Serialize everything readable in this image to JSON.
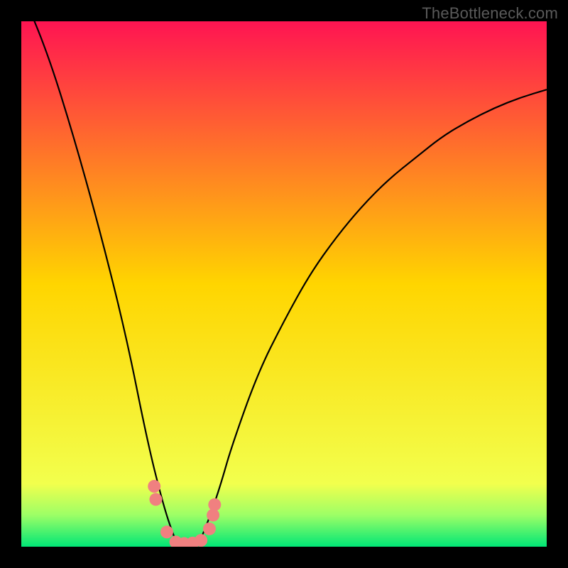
{
  "watermark": "TheBottleneck.com",
  "chart_data": {
    "type": "line",
    "title": "",
    "xlabel": "",
    "ylabel": "",
    "xlim": [
      0,
      100
    ],
    "ylim": [
      0,
      100
    ],
    "background_gradient": {
      "stops": [
        {
          "offset": 0,
          "color": "#ff1452"
        },
        {
          "offset": 50,
          "color": "#ffd500"
        },
        {
          "offset": 88,
          "color": "#f2ff4d"
        },
        {
          "offset": 94,
          "color": "#9cff66"
        },
        {
          "offset": 100,
          "color": "#00e676"
        }
      ]
    },
    "series": [
      {
        "name": "curve",
        "x": [
          0,
          5,
          10,
          15,
          20,
          24,
          27,
          29,
          30,
          31,
          32,
          33,
          34,
          36,
          38,
          40,
          45,
          50,
          55,
          60,
          65,
          70,
          75,
          80,
          85,
          90,
          95,
          100
        ],
        "y": [
          106,
          94,
          78,
          60,
          40,
          20,
          8,
          2,
          0,
          0,
          0,
          0,
          1,
          6,
          12,
          19,
          33,
          43,
          52,
          59,
          65,
          70,
          74,
          78,
          81,
          83.5,
          85.5,
          87
        ]
      }
    ],
    "markers": {
      "name": "highlight-dots",
      "radius": 9,
      "color": "#f08080",
      "points": [
        {
          "x": 25.3,
          "y": 11.5
        },
        {
          "x": 25.6,
          "y": 9.0
        },
        {
          "x": 27.7,
          "y": 2.8
        },
        {
          "x": 29.4,
          "y": 0.9
        },
        {
          "x": 31.0,
          "y": 0.6
        },
        {
          "x": 32.6,
          "y": 0.7
        },
        {
          "x": 34.2,
          "y": 1.2
        },
        {
          "x": 35.8,
          "y": 3.4
        },
        {
          "x": 36.5,
          "y": 6.0
        },
        {
          "x": 36.8,
          "y": 8.0
        }
      ]
    }
  }
}
